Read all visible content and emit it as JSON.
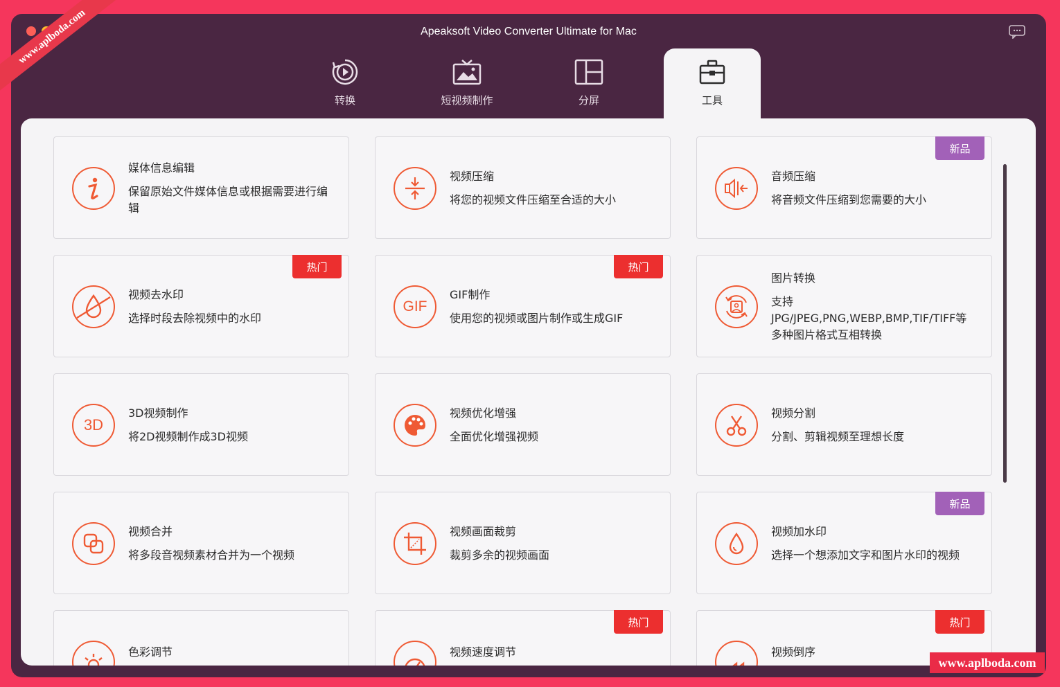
{
  "window": {
    "title": "Apeaksoft Video Converter Ultimate for Mac"
  },
  "tabs": [
    {
      "label": "转换",
      "icon": "convert-icon"
    },
    {
      "label": "短视频制作",
      "icon": "short-video-icon"
    },
    {
      "label": "分屏",
      "icon": "split-screen-icon"
    },
    {
      "label": "工具",
      "icon": "toolbox-icon",
      "active": true
    }
  ],
  "tools": [
    {
      "title": "媒体信息编辑",
      "desc": "保留原始文件媒体信息或根据需要进行编辑",
      "icon": "info-icon"
    },
    {
      "title": "视频压缩",
      "desc": "将您的视频文件压缩至合适的大小",
      "icon": "compress-icon"
    },
    {
      "title": "音频压缩",
      "desc": "将音频文件压缩到您需要的大小",
      "icon": "audio-compress-icon",
      "badge": "新品"
    },
    {
      "title": "视频去水印",
      "desc": "选择时段去除视频中的水印",
      "icon": "remove-watermark-icon",
      "badge": "热门"
    },
    {
      "title": "GIF制作",
      "desc": "使用您的视频或图片制作或生成GIF",
      "icon": "gif-icon",
      "badge": "热门",
      "iconText": "GIF"
    },
    {
      "title": "图片转换",
      "desc": "支持JPG/JPEG,PNG,WEBP,BMP,TIF/TIFF等多种图片格式互相转换",
      "icon": "image-convert-icon"
    },
    {
      "title": "3D视频制作",
      "desc": "将2D视频制作成3D视频",
      "icon": "3d-icon",
      "iconText": "3D"
    },
    {
      "title": "视频优化增强",
      "desc": "全面优化增强视频",
      "icon": "palette-icon"
    },
    {
      "title": "视频分割",
      "desc": "分割、剪辑视频至理想长度",
      "icon": "scissors-icon"
    },
    {
      "title": "视频合并",
      "desc": "将多段音视频素材合并为一个视频",
      "icon": "merge-icon"
    },
    {
      "title": "视频画面裁剪",
      "desc": "裁剪多余的视频画面",
      "icon": "crop-icon"
    },
    {
      "title": "视频加水印",
      "desc": "选择一个想添加文字和图片水印的视频",
      "icon": "add-watermark-icon",
      "badge": "新品"
    },
    {
      "title": "色彩调节",
      "desc": "",
      "icon": "color-adjust-icon"
    },
    {
      "title": "视频速度调节",
      "desc": "",
      "icon": "speed-icon",
      "badge": "热门"
    },
    {
      "title": "视频倒序",
      "desc": "",
      "icon": "reverse-icon",
      "badge": "热门"
    }
  ],
  "watermark": {
    "text": "www.aplboda.com"
  },
  "colors": {
    "accent": "#ef5a34",
    "window_bg": "#4a2642",
    "hot_badge": "#ec2f2f",
    "new_badge": "#a261b8"
  }
}
